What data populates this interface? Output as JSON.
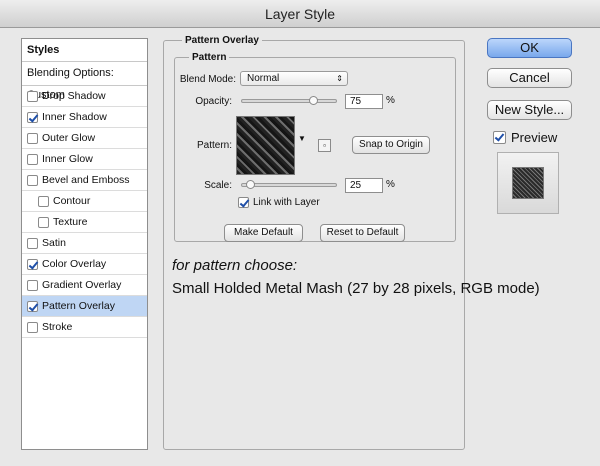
{
  "window": {
    "title": "Layer Style"
  },
  "sidebar": {
    "header": "Styles",
    "blending": "Blending Options: Custom",
    "items": [
      {
        "label": "Drop Shadow",
        "checked": false
      },
      {
        "label": "Inner Shadow",
        "checked": true
      },
      {
        "label": "Outer Glow",
        "checked": false
      },
      {
        "label": "Inner Glow",
        "checked": false
      },
      {
        "label": "Bevel and Emboss",
        "checked": false
      },
      {
        "label": "Contour",
        "checked": false
      },
      {
        "label": "Texture",
        "checked": false
      },
      {
        "label": "Satin",
        "checked": false
      },
      {
        "label": "Color Overlay",
        "checked": true
      },
      {
        "label": "Gradient Overlay",
        "checked": false
      },
      {
        "label": "Pattern Overlay",
        "checked": true,
        "selected": true
      },
      {
        "label": "Stroke",
        "checked": false
      }
    ]
  },
  "panel": {
    "title": "Pattern Overlay",
    "group_title": "Pattern",
    "blend_mode_label": "Blend Mode:",
    "blend_mode_value": "Normal",
    "opacity_label": "Opacity:",
    "opacity_value": "75",
    "opacity_unit": "%",
    "pattern_label": "Pattern:",
    "snap_button": "Snap to Origin",
    "scale_label": "Scale:",
    "scale_value": "25",
    "scale_unit": "%",
    "link_label": "Link with Layer",
    "link_checked": true,
    "make_default": "Make Default",
    "reset_default": "Reset to Default"
  },
  "note": {
    "line1": "for pattern choose:",
    "line2": "Small Holded Metal Mash (27 by 28 pixels, RGB mode)"
  },
  "actions": {
    "ok": "OK",
    "cancel": "Cancel",
    "new_style": "New Style...",
    "preview_label": "Preview",
    "preview_checked": true
  },
  "colors": {
    "accent": "#79a8ec",
    "selected_row": "#bfd6f4"
  }
}
